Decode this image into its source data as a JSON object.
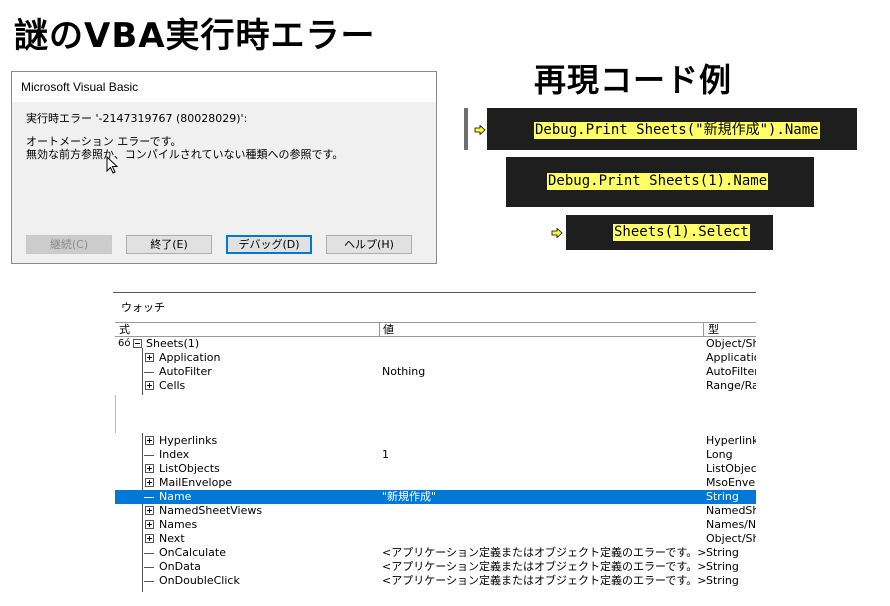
{
  "headings": {
    "title": "謎のVBA実行時エラー",
    "examples": "再現コード例"
  },
  "dialog": {
    "title": "Microsoft Visual Basic",
    "error_line": "実行時エラー '-2147319767 (80028029)':",
    "message_line1": "オートメーション エラーです。",
    "message_line2": "無効な前方参照か、コンパイルされていない種類への参照です。",
    "buttons": {
      "continue": "継続(C)",
      "end": "終了(E)",
      "debug": "デバッグ(D)",
      "help": "ヘルプ(H)"
    }
  },
  "code_samples": [
    {
      "text": "Debug.Print Sheets(\"新規作成\").Name",
      "current_line": true
    },
    {
      "text": "Debug.Print Sheets(1).Name",
      "current_line": false
    },
    {
      "text": "Sheets(1).Select",
      "current_line": true
    }
  ],
  "watch": {
    "title": "ウォッチ",
    "columns": {
      "expr": "式",
      "value": "値",
      "type": "型"
    },
    "root": {
      "expr": "Sheets(1)",
      "value": "",
      "type": "Object/Sh"
    },
    "rows_top": [
      {
        "expr": "Application",
        "value": "",
        "type": "Applicatio",
        "expandable": true
      },
      {
        "expr": "AutoFilter",
        "value": "Nothing",
        "type": "AutoFilter",
        "expandable": false
      },
      {
        "expr": "Cells",
        "value": "",
        "type": "Range/Ra",
        "expandable": true
      }
    ],
    "rows_bottom": [
      {
        "expr": "Hyperlinks",
        "value": "",
        "type": "Hyperlinks",
        "expandable": true
      },
      {
        "expr": "Index",
        "value": "1",
        "type": "Long",
        "expandable": false
      },
      {
        "expr": "ListObjects",
        "value": "",
        "type": "ListObject",
        "expandable": true
      },
      {
        "expr": "MailEnvelope",
        "value": "",
        "type": "MsoEnvelo",
        "expandable": true
      },
      {
        "expr": "Name",
        "value": "\"新規作成\"",
        "type": "String",
        "expandable": false,
        "selected": true
      },
      {
        "expr": "NamedSheetViews",
        "value": "",
        "type": "NamedShe",
        "expandable": true
      },
      {
        "expr": "Names",
        "value": "",
        "type": "Names/N",
        "expandable": true
      },
      {
        "expr": "Next",
        "value": "",
        "type": "Object/Sh",
        "expandable": true
      },
      {
        "expr": "OnCalculate",
        "value": "<アプリケーション定義またはオブジェクト定義のエラーです。>",
        "type": "String",
        "expandable": false
      },
      {
        "expr": "OnData",
        "value": "<アプリケーション定義またはオブジェクト定義のエラーです。>",
        "type": "String",
        "expandable": false
      },
      {
        "expr": "OnDoubleClick",
        "value": "<アプリケーション定義またはオブジェクト定義のエラーです。>",
        "type": "String",
        "expandable": false
      }
    ]
  },
  "colors": {
    "code_bg": "#1e1e1e",
    "code_highlight": "#ffff66",
    "selection": "#0078d7"
  }
}
